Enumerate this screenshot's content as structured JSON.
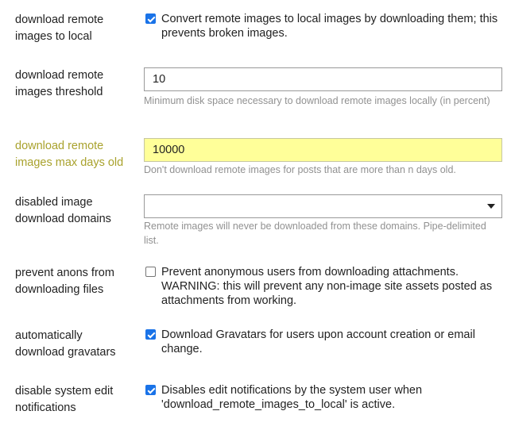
{
  "settings": [
    {
      "label": "download remote images to local",
      "type": "checkbox",
      "checked": true,
      "description": "Convert remote images to local images by downloading them; this prevents broken images."
    },
    {
      "label": "download remote images threshold",
      "type": "text",
      "value": "10",
      "help": "Minimum disk space necessary to download remote images locally (in percent)"
    },
    {
      "label": "download remote images max days old",
      "type": "text",
      "value": "10000",
      "changed": true,
      "help": "Don't download remote images for posts that are more than n days old."
    },
    {
      "label": "disabled image download domains",
      "type": "select",
      "value": "",
      "icon": "chevron-down-icon",
      "help": "Remote images will never be downloaded from these domains. Pipe-delimited list."
    },
    {
      "label": "prevent anons from downloading files",
      "type": "checkbox",
      "checked": false,
      "description": "Prevent anonymous users from downloading attachments. WARNING: this will prevent any non-image site assets posted as attachments from working."
    },
    {
      "label": "automatically download gravatars",
      "type": "checkbox",
      "checked": true,
      "description": "Download Gravatars for users upon account creation or email change."
    },
    {
      "label": "disable system edit notifications",
      "type": "checkbox",
      "checked": true,
      "description": "Disables edit notifications by the system user when 'download_remote_images_to_local' is active."
    }
  ],
  "colors": {
    "changed_label": "#a9a22d",
    "changed_input_bg": "#ffff99",
    "checkbox_accent": "#1a73e8",
    "help_text": "#919191"
  }
}
